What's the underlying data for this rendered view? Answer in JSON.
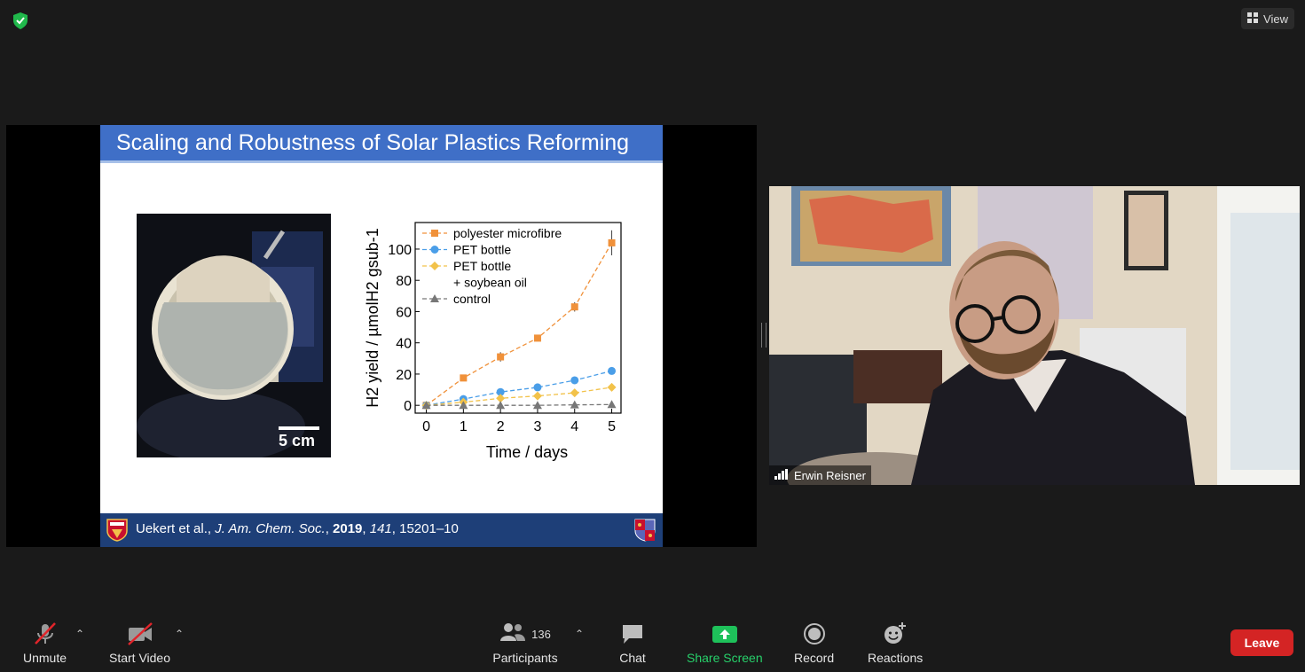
{
  "top": {
    "view_label": "View"
  },
  "slide": {
    "title": "Scaling and Robustness of Solar Plastics Reforming",
    "scale_label": "5 cm",
    "footer": {
      "authors": "Uekert et al., ",
      "journal": "J. Am. Chem. Soc.",
      "sep1": ", ",
      "year": "2019",
      "sep2": ", ",
      "volume": "141",
      "pages": ", 15201–10"
    }
  },
  "chart_data": {
    "type": "line",
    "xlabel": "Time / days",
    "ylabel": "H2 yield / µmolH2 gsub-1",
    "x": [
      0,
      1,
      2,
      3,
      4,
      5
    ],
    "xlim": [
      -0.3,
      5.25
    ],
    "ylim": [
      -5,
      117
    ],
    "xticks": [
      0,
      1,
      2,
      3,
      4,
      5
    ],
    "yticks": [
      0,
      20,
      40,
      60,
      80,
      100
    ],
    "legend_position": "top-left",
    "series": [
      {
        "name": "polyester microfibre",
        "color": "#f0913a",
        "marker": "square",
        "values": [
          0,
          17.5,
          31,
          43,
          63,
          104
        ],
        "errors": [
          1,
          1.5,
          3,
          2,
          3,
          8
        ]
      },
      {
        "name": "PET bottle",
        "color": "#4a9ee8",
        "marker": "circle",
        "values": [
          0,
          4,
          8.5,
          11.5,
          16,
          22
        ],
        "errors": [
          0.5,
          0.5,
          1,
          1,
          1,
          1
        ]
      },
      {
        "name": "PET bottle\n+ soybean oil",
        "color": "#f2c24a",
        "marker": "diamond",
        "values": [
          0,
          2,
          4.5,
          6,
          8,
          11.5
        ],
        "errors": [
          0.5,
          0.5,
          1,
          1,
          1.5,
          1.5
        ]
      },
      {
        "name": "control",
        "color": "#777777",
        "marker": "triangle",
        "values": [
          0,
          0,
          0,
          0,
          0.3,
          0.5
        ],
        "errors": [
          0,
          0,
          0,
          0,
          0,
          0
        ]
      }
    ]
  },
  "video": {
    "participant_name": "Erwin Reisner"
  },
  "toolbar": {
    "unmute": "Unmute",
    "start_video": "Start Video",
    "participants_count": "136",
    "participants": "Participants",
    "chat": "Chat",
    "share_screen": "Share Screen",
    "record": "Record",
    "reactions": "Reactions",
    "leave": "Leave"
  },
  "colors": {
    "share_green": "#1ec15a",
    "leave_red": "#d42424",
    "slide_blue": "#3f6fc7"
  }
}
